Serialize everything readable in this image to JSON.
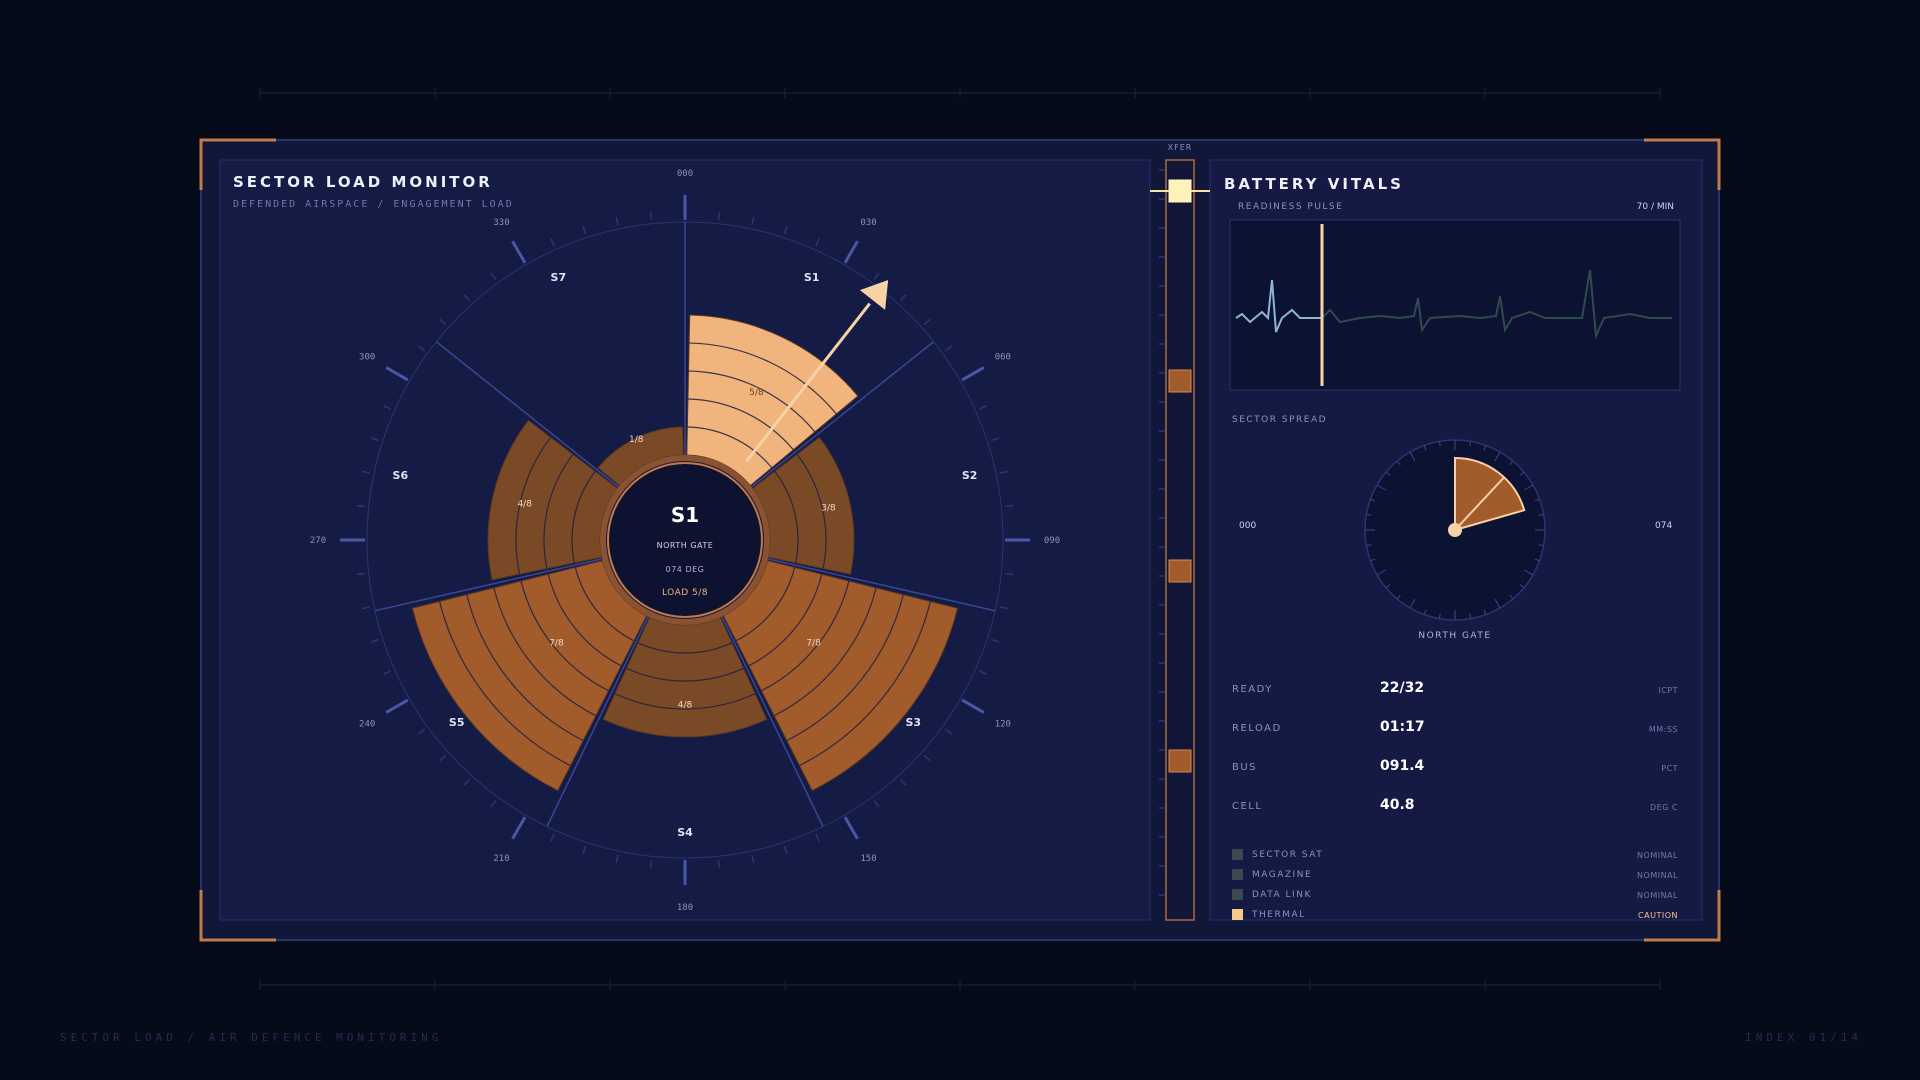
{
  "left_panel": {
    "title": "SECTOR LOAD MONITOR",
    "subtitle": "DEFENDED AIRSPACE / ENGAGEMENT LOAD"
  },
  "bearing_ticks": [
    "000",
    "030",
    "060",
    "090",
    "120",
    "150",
    "180",
    "210",
    "240",
    "270",
    "300",
    "330"
  ],
  "sectors": [
    {
      "id": "S1",
      "load_label": "5/8",
      "load": 5,
      "state": "selected"
    },
    {
      "id": "S2",
      "load_label": "3/8",
      "load": 3,
      "state": "normal"
    },
    {
      "id": "S3",
      "load_label": "7/8",
      "load": 7,
      "state": "high"
    },
    {
      "id": "S4",
      "load_label": "4/8",
      "load": 4,
      "state": "normal"
    },
    {
      "id": "S5",
      "load_label": "7/8",
      "load": 7,
      "state": "high"
    },
    {
      "id": "S6",
      "load_label": "4/8",
      "load": 4,
      "state": "normal"
    },
    {
      "id": "S7",
      "load_label": "1/8",
      "load": 1,
      "state": "normal"
    }
  ],
  "hub": {
    "id": "S1",
    "name": "NORTH GATE",
    "bearing": "074 DEG",
    "load": "LOAD 5/8"
  },
  "pointer_bearing_deg": 38,
  "xfer": {
    "label": "XFER",
    "slot_count": 4,
    "active_slot": 0
  },
  "right_panel": {
    "title": "BATTERY VITALS",
    "pulse_label": "READINESS PULSE",
    "pulse_rate": "70 / MIN",
    "spread_label": "SECTOR SPREAD",
    "spread_left": "000",
    "spread_right": "074",
    "spread_name": "NORTH GATE",
    "spread_start_deg": 0,
    "spread_end_deg": 74,
    "stats": [
      {
        "label": "READY",
        "value": "22/32",
        "unit": "ICPT"
      },
      {
        "label": "RELOAD",
        "value": "01:17",
        "unit": "MM:SS"
      },
      {
        "label": "BUS",
        "value": "091.4",
        "unit": "PCT"
      },
      {
        "label": "CELL",
        "value": "40.8",
        "unit": "DEG C"
      }
    ],
    "status": [
      {
        "label": "SECTOR SAT",
        "state": "NOMINAL",
        "color": "#3a4a4e"
      },
      {
        "label": "MAGAZINE",
        "state": "NOMINAL",
        "color": "#3a4a4e"
      },
      {
        "label": "DATA LINK",
        "state": "NOMINAL",
        "color": "#3a4a4e"
      },
      {
        "label": "THERMAL",
        "state": "CAUTION",
        "color": "#f6c98c"
      }
    ]
  },
  "footer": {
    "left": "SECTOR LOAD / AIR DEFENCE MONITORING",
    "right": "INDEX 01/14"
  },
  "colors": {
    "background": "#060b1a",
    "panel": "#141b45",
    "selected": "#f0b47c",
    "normal": "#7a4a26",
    "high": "#a25c2c",
    "accent": "#c27a48"
  }
}
